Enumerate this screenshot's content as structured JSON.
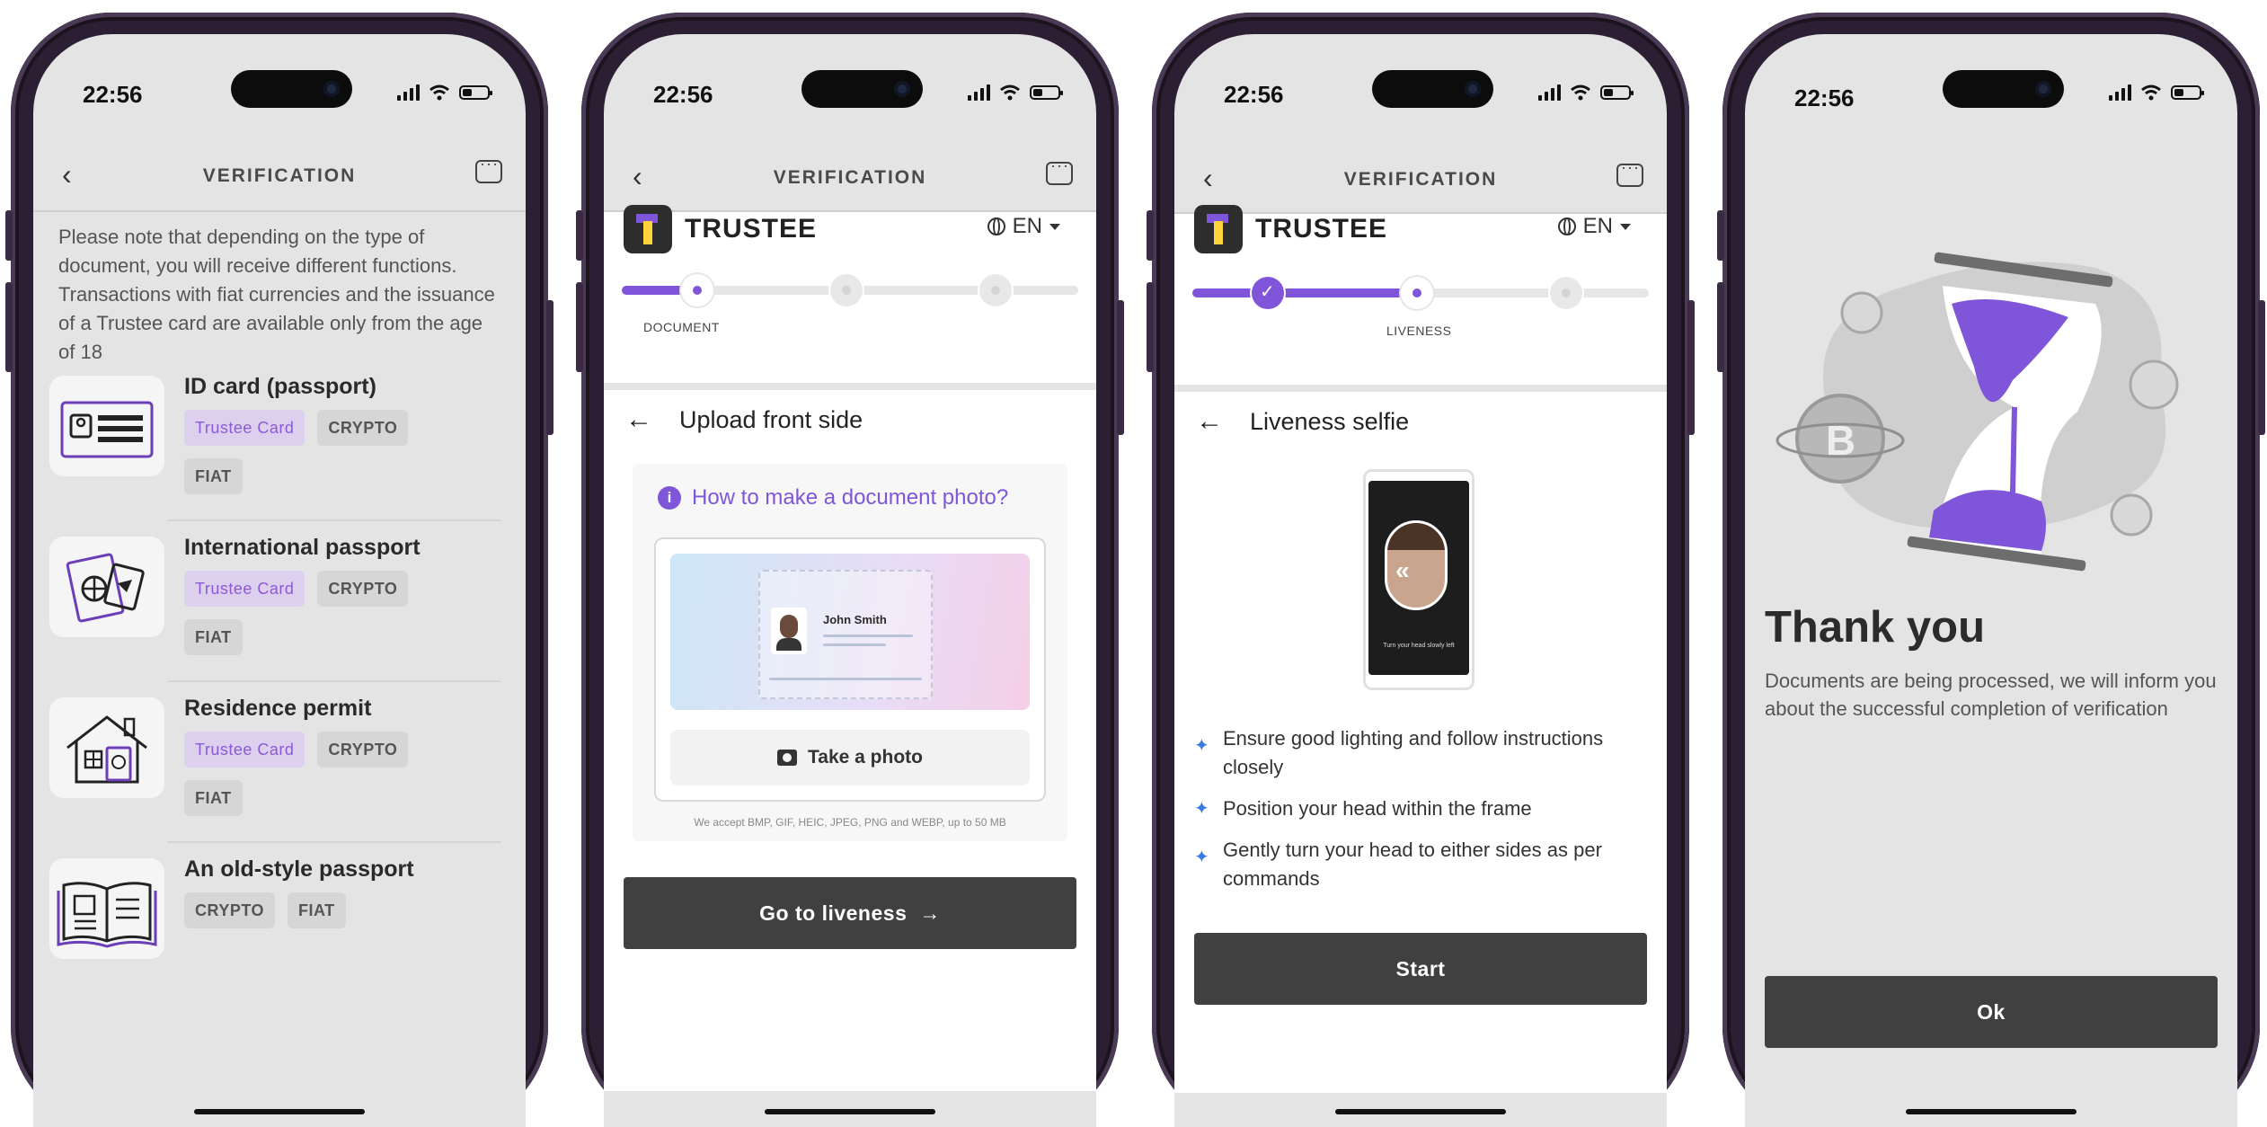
{
  "status_time": "22:56",
  "screen1": {
    "title": "VERIFICATION",
    "note": "Please note that depending on the type of document, you will receive different functions. Transactions with fiat currencies and the issuance of a Trustee card are available only from the age of 18",
    "documents": [
      {
        "name": "ID card (passport)",
        "icon": "id-card-icon",
        "tags": [
          "Trustee Card",
          "CRYPTO",
          "FIAT"
        ]
      },
      {
        "name": "International passport",
        "icon": "passport-icon",
        "tags": [
          "Trustee Card",
          "CRYPTO",
          "FIAT"
        ]
      },
      {
        "name": "Residence permit",
        "icon": "house-icon",
        "tags": [
          "Trustee Card",
          "CRYPTO",
          "FIAT"
        ]
      },
      {
        "name": "An old-style passport",
        "icon": "open-book-icon",
        "tags": [
          "CRYPTO",
          "FIAT"
        ]
      }
    ]
  },
  "screen2": {
    "title": "VERIFICATION",
    "brand": "TRUSTEE",
    "lang": "EN",
    "step_label": "DOCUMENT",
    "heading": "Upload front side",
    "howto": "How to make a document photo?",
    "sample_name": "John Smith",
    "take_photo": "Take a photo",
    "accept_note": "We accept BMP, GIF, HEIC, JPEG, PNG and WEBP, up to 50 MB",
    "cta": "Go to liveness",
    "cta_arrow": "→"
  },
  "screen3": {
    "title": "VERIFICATION",
    "brand": "TRUSTEE",
    "lang": "EN",
    "step_label": "LIVENESS",
    "heading": "Liveness selfie",
    "selfie_caption": "Turn your head slowly left",
    "tips": [
      "Ensure good lighting and follow instructions closely",
      "Position your head within the frame",
      "Gently turn your head to either sides as per commands"
    ],
    "cta": "Start"
  },
  "screen4": {
    "title": "Thank you",
    "message": "Documents are being processed, we will inform you about the successful completion of verification",
    "cta": "Ok"
  },
  "colors": {
    "accent": "#7f56d9",
    "button_dark": "#404040",
    "tag_purple_bg": "#ddd0ee",
    "tag_grey_bg": "#d6d6d6",
    "frame": "#2d1f33"
  }
}
